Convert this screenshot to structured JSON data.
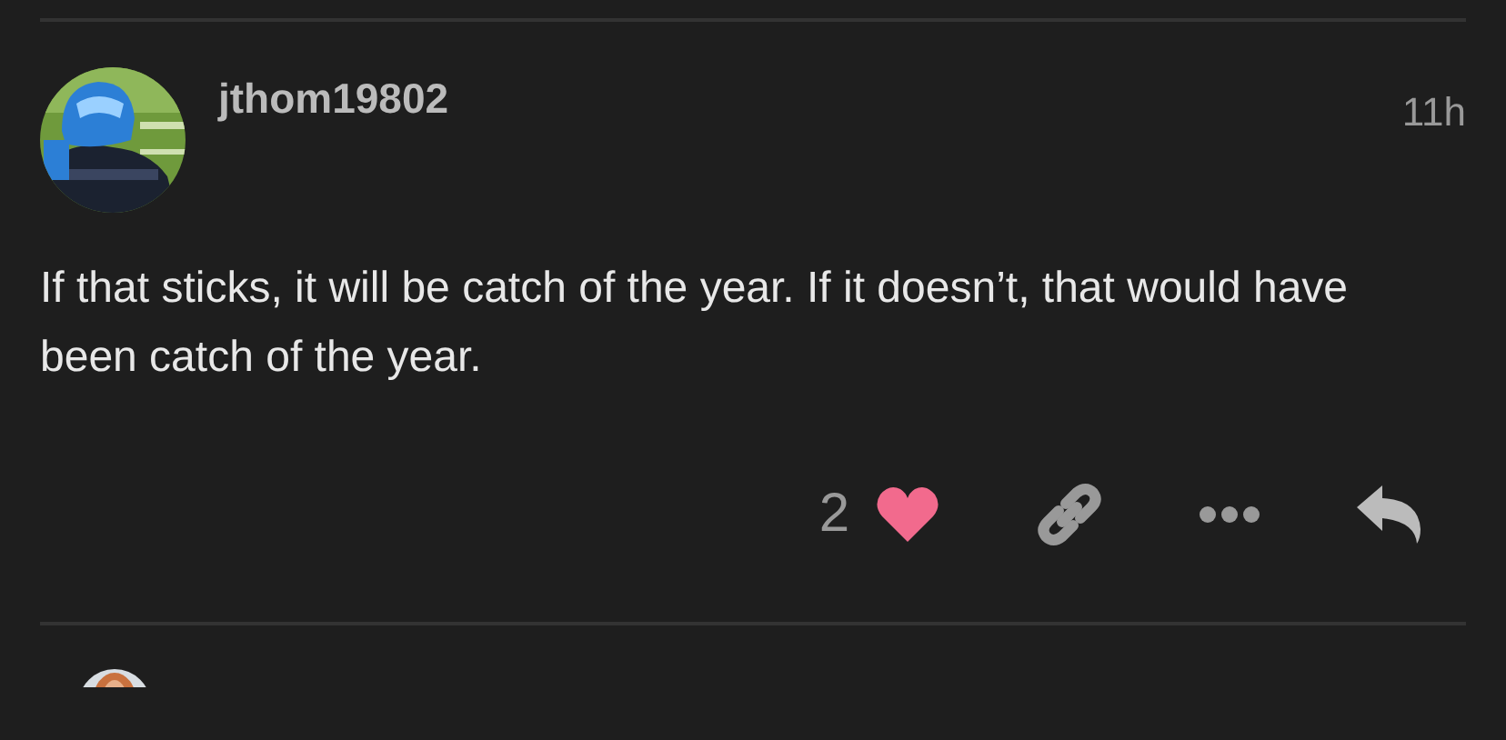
{
  "post": {
    "username": "jthom19802",
    "time": "11h",
    "body": "If that sticks, it will be catch of the year. If it doesn’t, that would have been catch of the year.",
    "likes": "2",
    "liked": true
  }
}
